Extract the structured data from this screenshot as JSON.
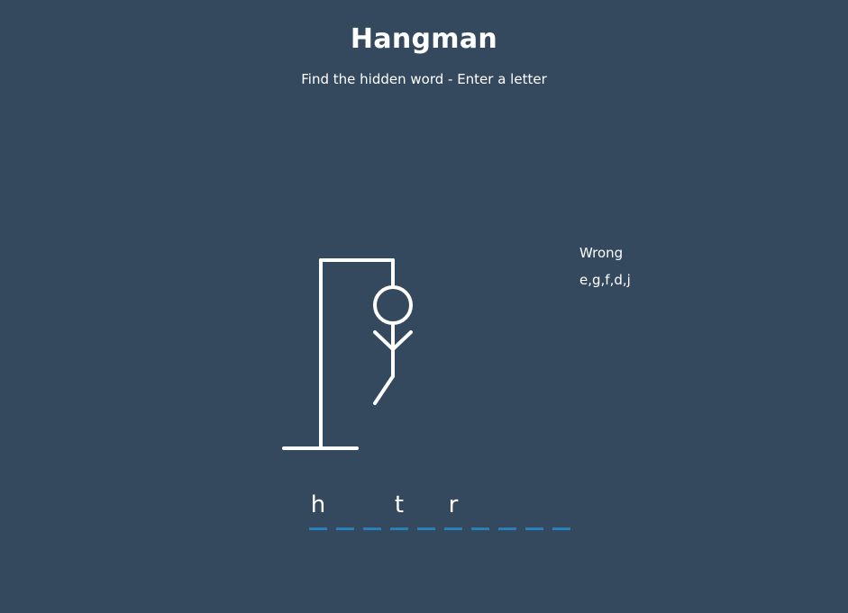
{
  "header": {
    "title": "Hangman",
    "subtitle": "Find the hidden word - Enter a letter"
  },
  "figure": {
    "wrong_guess_count": 5,
    "drawn_parts": [
      "gallows",
      "head",
      "body",
      "left-arm",
      "right-arm",
      "left-leg"
    ]
  },
  "wrong": {
    "label": "Wrong",
    "letters": "e,g,f,d,j"
  },
  "word": {
    "slots": [
      "h",
      "",
      "",
      "t",
      "",
      "r",
      "",
      "",
      "",
      ""
    ]
  },
  "colors": {
    "background": "#34495e",
    "text": "#ffffff",
    "slot_underline": "#2980b9",
    "figure_stroke": "#ffffff"
  }
}
